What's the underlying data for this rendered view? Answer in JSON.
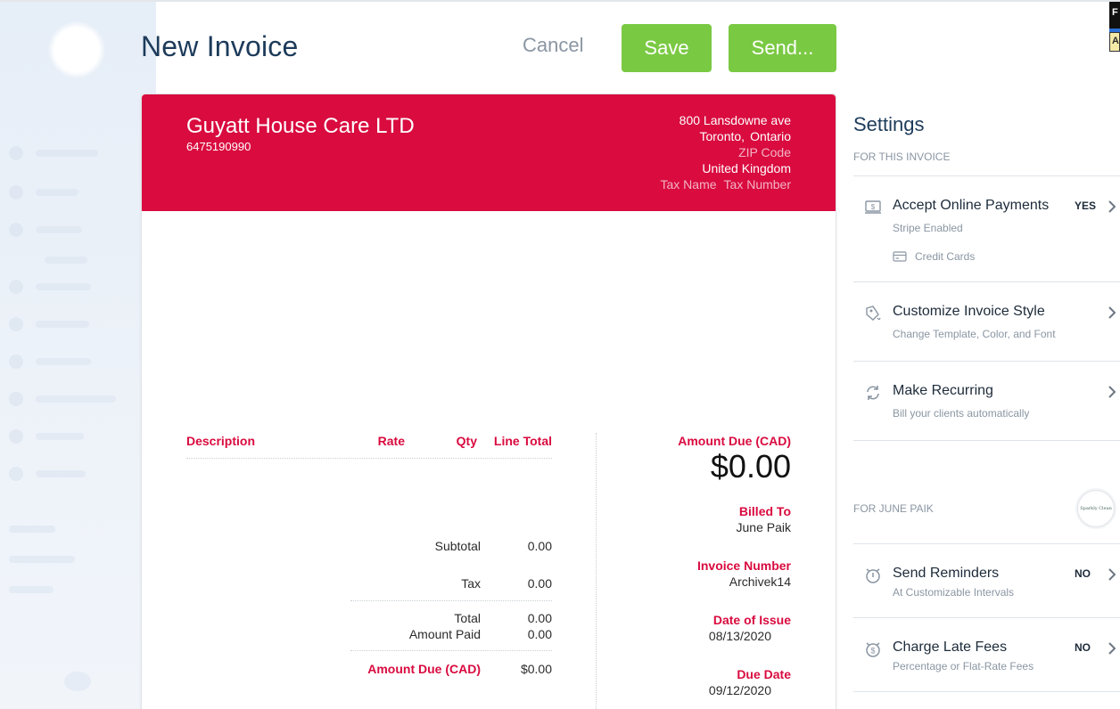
{
  "header": {
    "title": "New Invoice",
    "cancel_label": "Cancel",
    "save_label": "Save",
    "send_label": "Send..."
  },
  "corner_badge": {
    "top_letter": "F",
    "bottom_letter": "A"
  },
  "invoice": {
    "company_name": "Guyatt House Care LTD",
    "phone": "6475190990",
    "address_line1": "800 Lansdowne ave",
    "city": "Toronto,",
    "province": "Ontario",
    "zip": "ZIP Code",
    "country": "United Kingdom",
    "tax_name": "Tax Name",
    "tax_number": "Tax Number",
    "columns": {
      "description": "Description",
      "rate": "Rate",
      "qty": "Qty",
      "line_total": "Line Total"
    },
    "summary": {
      "subtotal_label": "Subtotal",
      "subtotal_value": "0.00",
      "tax_label": "Tax",
      "tax_value": "0.00",
      "total_label": "Total",
      "total_value": "0.00",
      "paid_label": "Amount Paid",
      "paid_value": "0.00",
      "due_label": "Amount Due (CAD)",
      "due_value": "$0.00"
    },
    "right": {
      "amount_due_label": "Amount Due (CAD)",
      "amount_due_value": "$0.00",
      "billed_to_label": "Billed To",
      "billed_to_value": "June Paik",
      "invoice_number_label": "Invoice Number",
      "invoice_number_value": "Archivek14",
      "date_issue_label": "Date of Issue",
      "date_issue_value": "08/13/2020",
      "due_date_label": "Due Date",
      "due_date_value": "09/12/2020"
    },
    "accent_color": "#d90b3f"
  },
  "settings": {
    "title": "Settings",
    "for_invoice_label": "FOR THIS INVOICE",
    "items": [
      {
        "title": "Accept Online Payments",
        "desc": "Stripe Enabled",
        "flag": "YES",
        "extra": "Credit Cards",
        "icon": "payment-screen-icon"
      },
      {
        "title": "Customize Invoice Style",
        "desc": "Change Template, Color, and Font",
        "icon": "paint-icon"
      },
      {
        "title": "Make Recurring",
        "desc": "Bill your clients automatically",
        "icon": "recurring-icon"
      }
    ],
    "for_client_label": "FOR JUNE PAIK",
    "client_logo_text": "Sparkly Clean",
    "client_items": [
      {
        "title": "Send Reminders",
        "desc": "At Customizable Intervals",
        "flag": "NO",
        "icon": "alarm-clock-icon"
      },
      {
        "title": "Charge Late Fees",
        "desc": "Percentage or Flat-Rate Fees",
        "flag": "NO",
        "icon": "late-fee-icon"
      }
    ]
  },
  "colors": {
    "primary_button": "#7ac943",
    "heading": "#1d3b5a",
    "muted": "#8a96a3"
  }
}
